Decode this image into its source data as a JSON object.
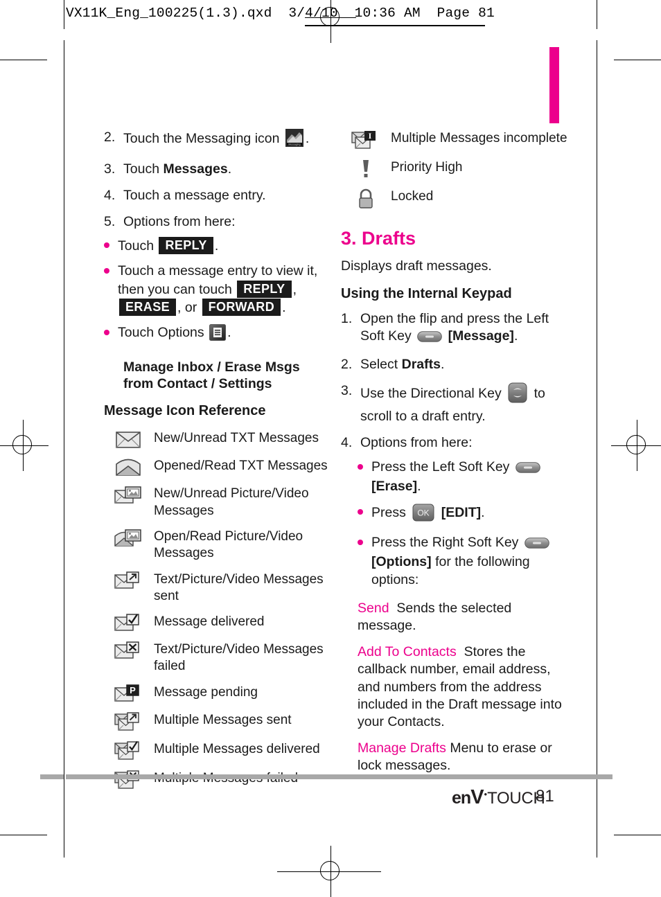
{
  "print_header": {
    "text": "VX11K_Eng_100225(1.3).qxd  3/4/10  10:36 AM  Page 81"
  },
  "accent_color": "#ec008c",
  "left_column": {
    "steps": [
      {
        "num": "2.",
        "pre": "Touch the Messaging icon",
        "icon": "messaging-app-icon",
        "post": "."
      },
      {
        "num": "3.",
        "pre": "Touch",
        "strong": "Messages",
        "post": "."
      },
      {
        "num": "4.",
        "pre": "Touch a message entry.",
        "strong": "",
        "post": ""
      },
      {
        "num": "5.",
        "pre": "Options from here:",
        "strong": "",
        "post": ""
      }
    ],
    "bullets": [
      {
        "pre": "Touch",
        "keys": [
          "REPLY"
        ],
        "post": "."
      },
      {
        "pre": "Touch a message entry to view it, then you can touch",
        "keys": [
          "REPLY",
          "ERASE",
          "FORWARD"
        ],
        "sep1": ",",
        "sep2": ", or",
        "post": "."
      },
      {
        "pre": "Touch Options",
        "icon": "options-list-icon",
        "post": "."
      }
    ],
    "subhead": "Manage Inbox / Erase Msgs from Contact / Settings",
    "icon_reference_heading": "Message Icon Reference",
    "icon_reference": [
      {
        "icon": "envelope-closed-icon",
        "label": "New/Unread TXT Messages"
      },
      {
        "icon": "envelope-open-icon",
        "label": "Opened/Read TXT Messages"
      },
      {
        "icon": "envelope-picture-new-icon",
        "label": "New/Unread Picture/Video Messages"
      },
      {
        "icon": "envelope-picture-open-icon",
        "label": "Open/Read Picture/Video Messages"
      },
      {
        "icon": "envelope-sent-arrow-icon",
        "label": "Text/Picture/Video Messages sent"
      },
      {
        "icon": "envelope-check-icon",
        "label": "Message delivered"
      },
      {
        "icon": "envelope-x-icon",
        "label": "Text/Picture/Video Messages failed"
      },
      {
        "icon": "envelope-pending-p-icon",
        "label": "Message pending"
      },
      {
        "icon": "multi-envelope-arrow-icon",
        "label": "Multiple Messages sent"
      },
      {
        "icon": "multi-envelope-check-icon",
        "label": "Multiple Messages delivered"
      },
      {
        "icon": "multi-envelope-x-icon",
        "label": "Multiple Messages failed"
      }
    ]
  },
  "right_column": {
    "icon_reference_continued": [
      {
        "icon": "multi-envelope-incomplete-icon",
        "label": "Multiple Messages incomplete"
      },
      {
        "icon": "priority-high-icon",
        "label": "Priority High"
      },
      {
        "icon": "lock-icon",
        "label": "Locked"
      }
    ],
    "section_title": "3. Drafts",
    "section_desc": "Displays draft messages.",
    "keypad_heading": "Using the Internal Keypad",
    "steps": [
      {
        "num": "1.",
        "pre": "Open the flip and press the Left Soft Key",
        "icon": "soft-key-icon",
        "strong": "[Message]",
        "post": "."
      },
      {
        "num": "2.",
        "pre": "Select",
        "strong": "Drafts",
        "post": "."
      },
      {
        "num": "3.",
        "pre": "Use the Directional Key",
        "icon": "directional-key-icon",
        "post": "to scroll to a draft entry."
      },
      {
        "num": "4.",
        "pre": "Options from here:",
        "post": ""
      }
    ],
    "bullets": [
      {
        "pre": "Press the Left Soft Key",
        "icon": "soft-key-icon",
        "strong": "[Erase]",
        "post": "."
      },
      {
        "pre": "Press",
        "icon": "ok-key-icon",
        "strong": "[EDIT]",
        "post": "."
      },
      {
        "pre": "Press the Right Soft Key",
        "icon": "soft-key-icon",
        "strong": "[Options]",
        "post": "for the following options:"
      }
    ],
    "options": [
      {
        "term": "Send",
        "desc": "Sends the selected message."
      },
      {
        "term": "Add To Contacts",
        "desc": "Stores the callback number, email address, and numbers from the address included in the Draft message into your Contacts."
      },
      {
        "term": "Manage Drafts",
        "desc": "Menu to erase or lock messages."
      }
    ]
  },
  "footer": {
    "brand_en": "en",
    "brand_v": "V",
    "brand_star": "•",
    "brand_touch": "TOUCH",
    "page_number": "81"
  }
}
